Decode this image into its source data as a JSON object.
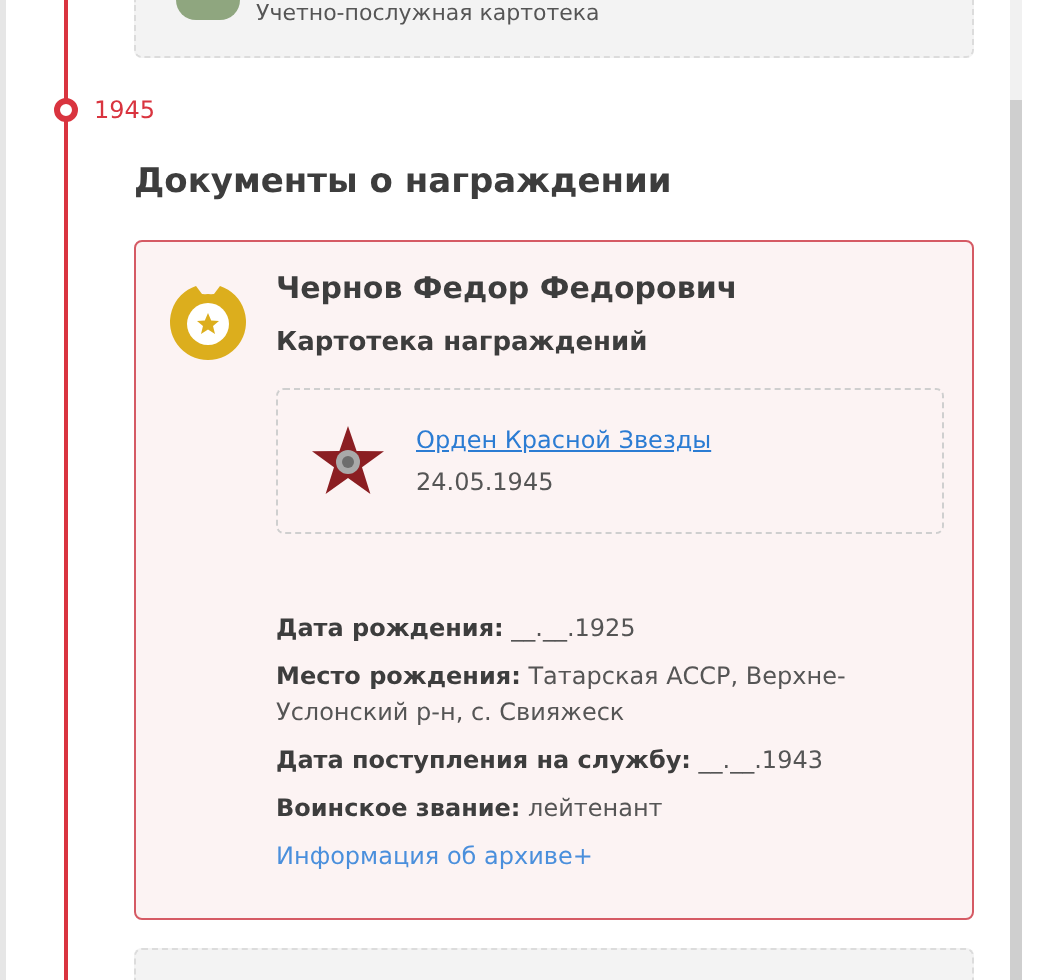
{
  "previous_card": {
    "title": "Учетно-послужная картотека"
  },
  "timeline_year": "1945",
  "section_title": "Документы о награждении",
  "award_card": {
    "name": "Чернов Федор Федорович",
    "subtitle": "Картотека награждений",
    "award": {
      "link": "Орден Красной Звезды",
      "date": "24.05.1945"
    },
    "fields": [
      {
        "text": "**Дата рождения:** __.__.1925"
      },
      {
        "text": "**Место рождения:** Татарская АССР, Верхне-Услонский р-н, с. Свияжеск"
      },
      {
        "text": "**Дата поступления на службу:** __.__.1943"
      },
      {
        "text": "**Воинское звание:** лейтенант"
      }
    ],
    "archive_link": "Информация об архиве+"
  }
}
